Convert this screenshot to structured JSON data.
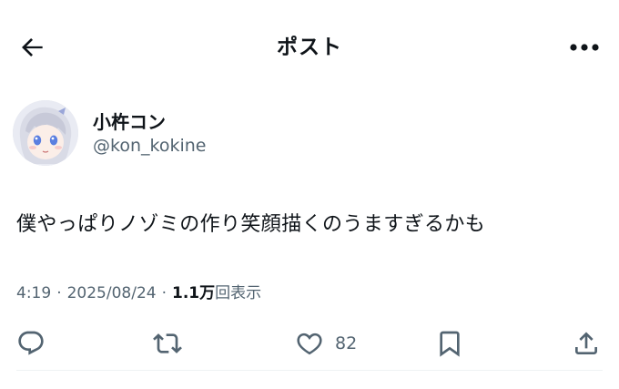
{
  "header": {
    "title": "ポスト"
  },
  "author": {
    "display_name": "小杵コン",
    "handle": "@kon_kokine"
  },
  "post": {
    "text": "僕やっぱりノゾミの作り笑顔描くのうますぎるかも"
  },
  "meta": {
    "time": "4:19",
    "date": "2025/08/24",
    "views_count": "1.1万",
    "views_label": "回表示",
    "separator": "·"
  },
  "actions": {
    "reply_icon": "reply-icon",
    "repost_icon": "repost-icon",
    "like_icon": "like-icon",
    "like_count": "82",
    "bookmark_icon": "bookmark-icon",
    "share_icon": "share-icon"
  },
  "colors": {
    "text_primary": "#0f1419",
    "text_secondary": "#536471",
    "divider": "#eff3f4"
  }
}
